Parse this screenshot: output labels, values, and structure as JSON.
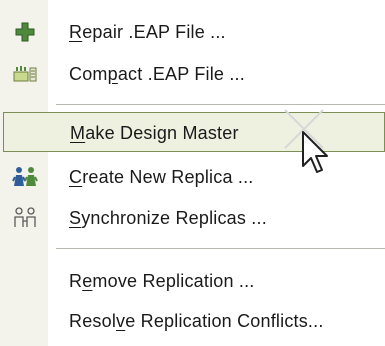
{
  "menu": {
    "items": [
      {
        "pre": "",
        "key": "R",
        "post": "epair .EAP File ...",
        "icon": "repair-plus-icon"
      },
      {
        "pre": "Com",
        "key": "p",
        "post": "act .EAP File ...",
        "icon": "compact-database-icon"
      },
      {
        "pre": "",
        "key": "M",
        "post": "ake Design Master",
        "icon": ""
      },
      {
        "pre": "",
        "key": "C",
        "post": "reate New Replica ...",
        "icon": "create-replica-people-icon"
      },
      {
        "pre": "",
        "key": "S",
        "post": "ynchronize Replicas ...",
        "icon": "synchronize-replicas-icon"
      },
      {
        "pre": "R",
        "key": "e",
        "post": "move Replication ...",
        "icon": ""
      },
      {
        "pre": "Resol",
        "key": "v",
        "post": "e Replication Conflicts...",
        "icon": ""
      }
    ],
    "highlighted_index": 2
  },
  "colors": {
    "gutter": "#f3f3ec",
    "highlight_bg": "#eef0e0",
    "highlight_border": "#7b8f54",
    "separator": "#b9b9b0",
    "icon_green": "#4f8a3c",
    "icon_blue": "#2f5f9b"
  }
}
